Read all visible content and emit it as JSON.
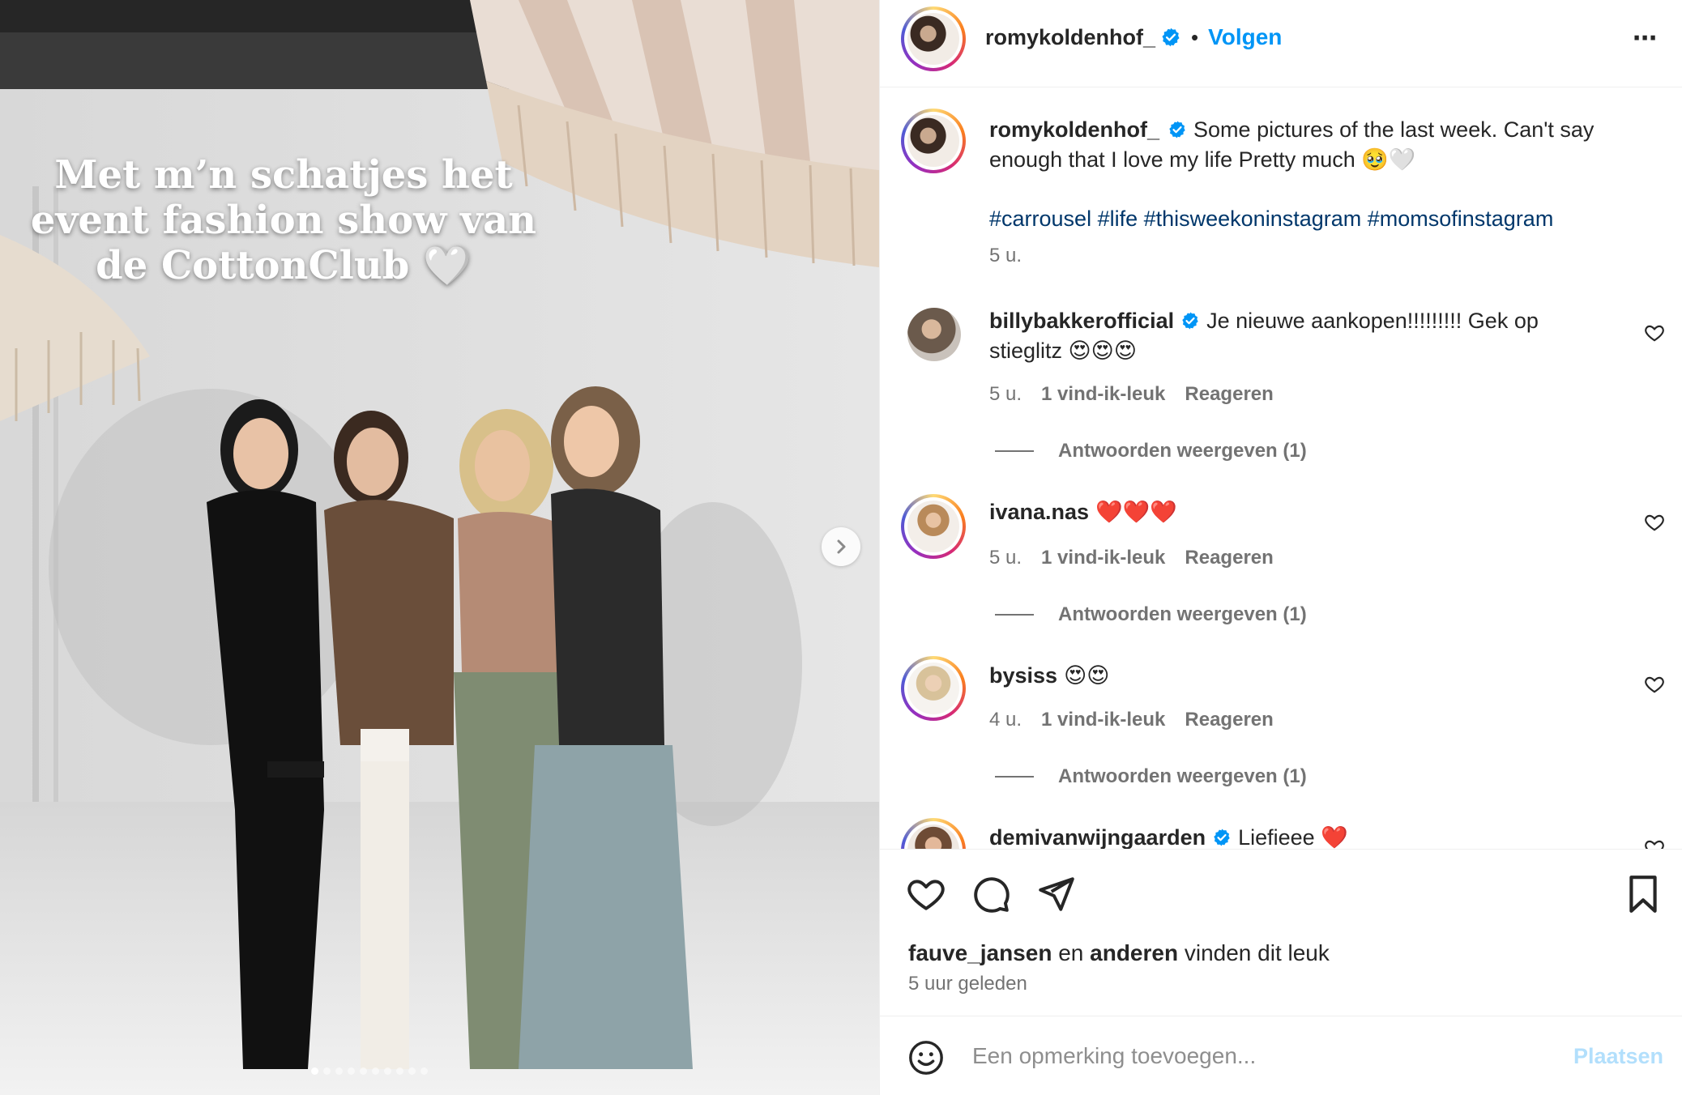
{
  "post": {
    "author": "romykoldenhof_",
    "follow_label": "Volgen",
    "more_label": "⋯",
    "overlay_lines": [
      "Met m’n schatjes het",
      "event fashion show van",
      "de CottonClub 🤍"
    ],
    "caption_text": "Some pictures of the last week. Can't say enough that I love my life Pretty much 🥹🤍",
    "hashtags": "#carrousel #life #thisweekoninstagram #momsofinstagram",
    "caption_time": "5 u."
  },
  "comments": [
    {
      "user": "billybakkerofficial",
      "verified": true,
      "text": "Je nieuwe aankopen!!!!!!!!! Gek op stieglitz 😍😍😍",
      "time": "5 u.",
      "likes": "1 vind-ik-leuk",
      "reply": "Reageren",
      "view_replies": "Antwoorden weergeven (1)"
    },
    {
      "user": "ivana.nas",
      "verified": false,
      "text": "❤️❤️❤️",
      "time": "5 u.",
      "likes": "1 vind-ik-leuk",
      "reply": "Reageren",
      "view_replies": "Antwoorden weergeven (1)"
    },
    {
      "user": "bysiss",
      "verified": false,
      "text": "😍😍",
      "time": "4 u.",
      "likes": "1 vind-ik-leuk",
      "reply": "Reageren",
      "view_replies": "Antwoorden weergeven (1)"
    },
    {
      "user": "demivanwijngaarden",
      "verified": true,
      "text": "Liefieee ❤️"
    }
  ],
  "footer": {
    "liked_by_user": "fauve_jansen",
    "liked_by_and": "en",
    "liked_by_others": "anderen",
    "liked_by_suffix": "vinden dit leuk",
    "posted": "5 uur geleden",
    "comment_placeholder": "Een opmerking toevoegen...",
    "post_label": "Plaatsen"
  },
  "colors": {
    "accent": "#0095f6",
    "verified": "#0095f6",
    "hashtag": "#00376b",
    "muted": "#737373",
    "post_disabled": "#b2dffc"
  },
  "icons": {
    "next": "chevron-right-icon",
    "more": "more-horizontal-icon",
    "verified": "verified-badge-icon",
    "like": "heart-icon",
    "comment": "comment-icon",
    "share": "send-icon",
    "save": "bookmark-icon",
    "emoji": "emoji-icon"
  },
  "carousel": {
    "total": 10,
    "active": 1
  }
}
